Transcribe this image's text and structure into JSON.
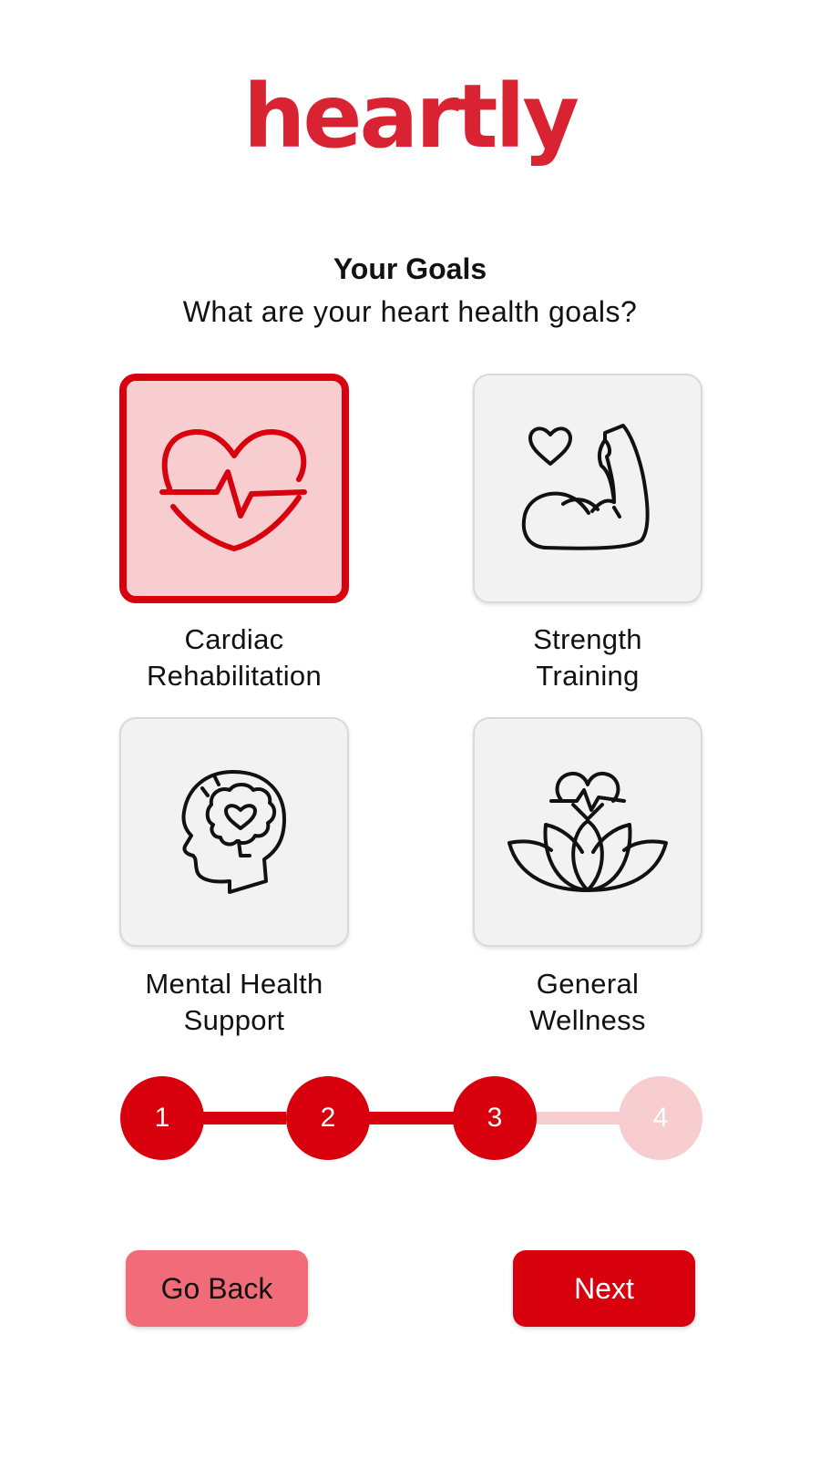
{
  "app": {
    "logo_text": "heartly",
    "brand_color": "#d92332",
    "accent_color": "#d9000d"
  },
  "header": {
    "title": "Your Goals",
    "subtitle": "What are your heart health goals?"
  },
  "goals": [
    {
      "label": "Cardiac\nRehabilitation",
      "icon": "heart-pulse-icon",
      "selected": true
    },
    {
      "label": "Strength\nTraining",
      "icon": "flexed-arm-heart-icon",
      "selected": false
    },
    {
      "label": "Mental Health\nSupport",
      "icon": "head-brain-heart-icon",
      "selected": false
    },
    {
      "label": "General\nWellness",
      "icon": "lotus-heart-icon",
      "selected": false
    }
  ],
  "stepper": {
    "steps": [
      "1",
      "2",
      "3",
      "4"
    ],
    "current_step": 3,
    "total_steps": 4
  },
  "buttons": {
    "back_label": "Go Back",
    "next_label": "Next"
  }
}
